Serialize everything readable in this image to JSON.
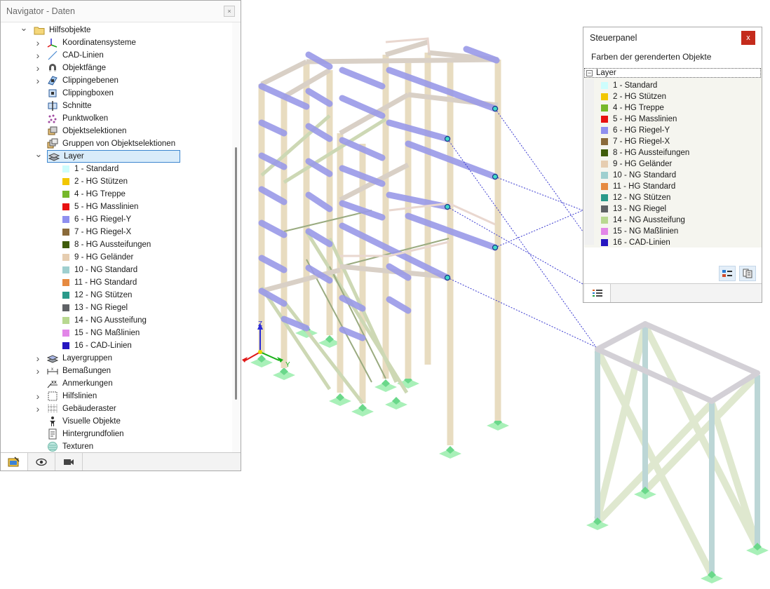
{
  "navigator": {
    "title": "Navigator - Daten",
    "close_label": "×",
    "root": {
      "label": "Hilfsobjekte",
      "icon": "folder-icon"
    },
    "items_top": [
      {
        "label": "Koordinatensysteme",
        "icon": "coordinate-system-icon"
      },
      {
        "label": "CAD-Linien",
        "icon": "cad-line-icon"
      },
      {
        "label": "Objektfänge",
        "icon": "magnet-icon"
      },
      {
        "label": "Clippingebenen",
        "icon": "clipping-plane-icon"
      },
      {
        "label": "Clippingboxen",
        "icon": "clipping-box-icon"
      },
      {
        "label": "Schnitte",
        "icon": "section-icon"
      },
      {
        "label": "Punktwolken",
        "icon": "point-cloud-icon"
      },
      {
        "label": "Objektselektionen",
        "icon": "object-selection-icon"
      },
      {
        "label": "Gruppen von Objektselektionen",
        "icon": "selection-group-icon"
      }
    ],
    "layer_node": {
      "label": "Layer",
      "icon": "layer-icon"
    },
    "layers": [
      {
        "label": "1 - Standard",
        "color": "#cdfdfd"
      },
      {
        "label": "2 - HG Stützen",
        "color": "#f2c700"
      },
      {
        "label": "4 - HG Treppe",
        "color": "#76b82a"
      },
      {
        "label": "5 - HG Masslinien",
        "color": "#e81010"
      },
      {
        "label": "6 - HG Riegel-Y",
        "color": "#8f8fef"
      },
      {
        "label": "7 - HG Riegel-X",
        "color": "#8a6a3a"
      },
      {
        "label": "8 - HG Aussteifungen",
        "color": "#3f5c0a"
      },
      {
        "label": "9 - HG Geländer",
        "color": "#e6cdb0"
      },
      {
        "label": "10 - NG Standard",
        "color": "#9fcfcf"
      },
      {
        "label": "11 - HG Standard",
        "color": "#e68a40"
      },
      {
        "label": "12 - NG Stützen",
        "color": "#2a9a8a"
      },
      {
        "label": "13 - NG Riegel",
        "color": "#5f6266"
      },
      {
        "label": "14 - NG Aussteifung",
        "color": "#b8d890"
      },
      {
        "label": "15 - NG Maßlinien",
        "color": "#e286e8"
      },
      {
        "label": "16 - CAD-Linien",
        "color": "#2616c0"
      }
    ],
    "items_bottom": [
      {
        "label": "Layergruppen",
        "icon": "layer-group-icon",
        "expandable": true
      },
      {
        "label": "Bemaßungen",
        "icon": "dimension-icon",
        "expandable": true
      },
      {
        "label": "Anmerkungen",
        "icon": "annotation-icon",
        "expandable": false
      },
      {
        "label": "Hilfslinien",
        "icon": "guide-line-icon",
        "expandable": true
      },
      {
        "label": "Gebäuderaster",
        "icon": "building-grid-icon",
        "expandable": true
      },
      {
        "label": "Visuelle Objekte",
        "icon": "visual-object-icon",
        "expandable": false
      },
      {
        "label": "Hintergrundfolien",
        "icon": "background-layer-icon",
        "expandable": false
      },
      {
        "label": "Texturen",
        "icon": "texture-icon",
        "expandable": false
      }
    ],
    "tabs": [
      "data-tab-icon",
      "eye-icon",
      "camera-icon"
    ]
  },
  "steuerpanel": {
    "title": "Steuerpanel",
    "close_label": "x",
    "subtitle": "Farben der gerenderten Objekte",
    "group_label": "Layer",
    "tools": [
      "layer-settings-icon",
      "layer-copy-icon"
    ],
    "tab_icon": "list-icon"
  },
  "axes": {
    "z": "Z",
    "y": "Y"
  }
}
